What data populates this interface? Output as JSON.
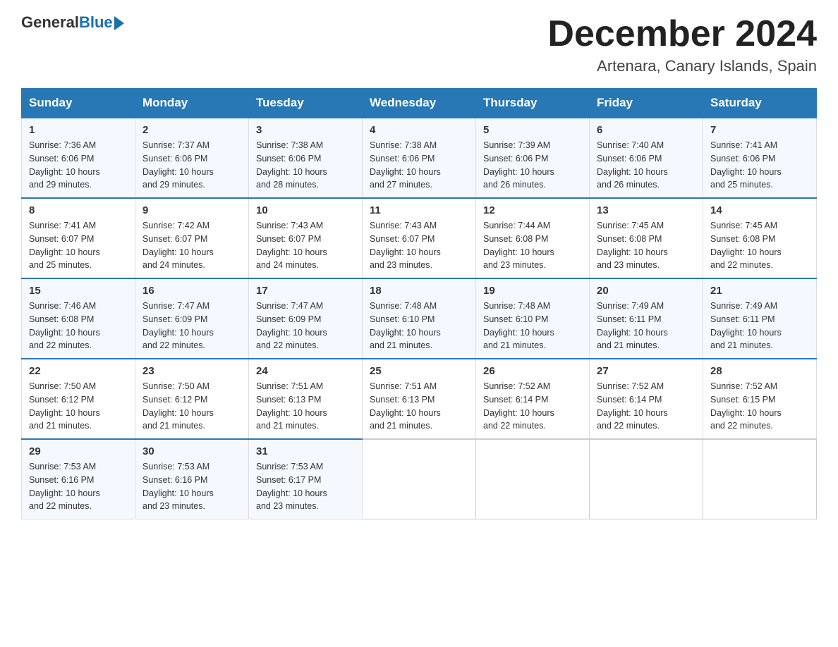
{
  "header": {
    "logo_general": "General",
    "logo_blue": "Blue",
    "month_title": "December 2024",
    "location": "Artenara, Canary Islands, Spain"
  },
  "days_of_week": [
    "Sunday",
    "Monday",
    "Tuesday",
    "Wednesday",
    "Thursday",
    "Friday",
    "Saturday"
  ],
  "weeks": [
    [
      {
        "day": "1",
        "sunrise": "7:36 AM",
        "sunset": "6:06 PM",
        "daylight": "10 hours and 29 minutes."
      },
      {
        "day": "2",
        "sunrise": "7:37 AM",
        "sunset": "6:06 PM",
        "daylight": "10 hours and 29 minutes."
      },
      {
        "day": "3",
        "sunrise": "7:38 AM",
        "sunset": "6:06 PM",
        "daylight": "10 hours and 28 minutes."
      },
      {
        "day": "4",
        "sunrise": "7:38 AM",
        "sunset": "6:06 PM",
        "daylight": "10 hours and 27 minutes."
      },
      {
        "day": "5",
        "sunrise": "7:39 AM",
        "sunset": "6:06 PM",
        "daylight": "10 hours and 26 minutes."
      },
      {
        "day": "6",
        "sunrise": "7:40 AM",
        "sunset": "6:06 PM",
        "daylight": "10 hours and 26 minutes."
      },
      {
        "day": "7",
        "sunrise": "7:41 AM",
        "sunset": "6:06 PM",
        "daylight": "10 hours and 25 minutes."
      }
    ],
    [
      {
        "day": "8",
        "sunrise": "7:41 AM",
        "sunset": "6:07 PM",
        "daylight": "10 hours and 25 minutes."
      },
      {
        "day": "9",
        "sunrise": "7:42 AM",
        "sunset": "6:07 PM",
        "daylight": "10 hours and 24 minutes."
      },
      {
        "day": "10",
        "sunrise": "7:43 AM",
        "sunset": "6:07 PM",
        "daylight": "10 hours and 24 minutes."
      },
      {
        "day": "11",
        "sunrise": "7:43 AM",
        "sunset": "6:07 PM",
        "daylight": "10 hours and 23 minutes."
      },
      {
        "day": "12",
        "sunrise": "7:44 AM",
        "sunset": "6:08 PM",
        "daylight": "10 hours and 23 minutes."
      },
      {
        "day": "13",
        "sunrise": "7:45 AM",
        "sunset": "6:08 PM",
        "daylight": "10 hours and 23 minutes."
      },
      {
        "day": "14",
        "sunrise": "7:45 AM",
        "sunset": "6:08 PM",
        "daylight": "10 hours and 22 minutes."
      }
    ],
    [
      {
        "day": "15",
        "sunrise": "7:46 AM",
        "sunset": "6:08 PM",
        "daylight": "10 hours and 22 minutes."
      },
      {
        "day": "16",
        "sunrise": "7:47 AM",
        "sunset": "6:09 PM",
        "daylight": "10 hours and 22 minutes."
      },
      {
        "day": "17",
        "sunrise": "7:47 AM",
        "sunset": "6:09 PM",
        "daylight": "10 hours and 22 minutes."
      },
      {
        "day": "18",
        "sunrise": "7:48 AM",
        "sunset": "6:10 PM",
        "daylight": "10 hours and 21 minutes."
      },
      {
        "day": "19",
        "sunrise": "7:48 AM",
        "sunset": "6:10 PM",
        "daylight": "10 hours and 21 minutes."
      },
      {
        "day": "20",
        "sunrise": "7:49 AM",
        "sunset": "6:11 PM",
        "daylight": "10 hours and 21 minutes."
      },
      {
        "day": "21",
        "sunrise": "7:49 AM",
        "sunset": "6:11 PM",
        "daylight": "10 hours and 21 minutes."
      }
    ],
    [
      {
        "day": "22",
        "sunrise": "7:50 AM",
        "sunset": "6:12 PM",
        "daylight": "10 hours and 21 minutes."
      },
      {
        "day": "23",
        "sunrise": "7:50 AM",
        "sunset": "6:12 PM",
        "daylight": "10 hours and 21 minutes."
      },
      {
        "day": "24",
        "sunrise": "7:51 AM",
        "sunset": "6:13 PM",
        "daylight": "10 hours and 21 minutes."
      },
      {
        "day": "25",
        "sunrise": "7:51 AM",
        "sunset": "6:13 PM",
        "daylight": "10 hours and 21 minutes."
      },
      {
        "day": "26",
        "sunrise": "7:52 AM",
        "sunset": "6:14 PM",
        "daylight": "10 hours and 22 minutes."
      },
      {
        "day": "27",
        "sunrise": "7:52 AM",
        "sunset": "6:14 PM",
        "daylight": "10 hours and 22 minutes."
      },
      {
        "day": "28",
        "sunrise": "7:52 AM",
        "sunset": "6:15 PM",
        "daylight": "10 hours and 22 minutes."
      }
    ],
    [
      {
        "day": "29",
        "sunrise": "7:53 AM",
        "sunset": "6:16 PM",
        "daylight": "10 hours and 22 minutes."
      },
      {
        "day": "30",
        "sunrise": "7:53 AM",
        "sunset": "6:16 PM",
        "daylight": "10 hours and 23 minutes."
      },
      {
        "day": "31",
        "sunrise": "7:53 AM",
        "sunset": "6:17 PM",
        "daylight": "10 hours and 23 minutes."
      },
      null,
      null,
      null,
      null
    ]
  ],
  "labels": {
    "sunrise": "Sunrise:",
    "sunset": "Sunset:",
    "daylight": "Daylight:"
  }
}
